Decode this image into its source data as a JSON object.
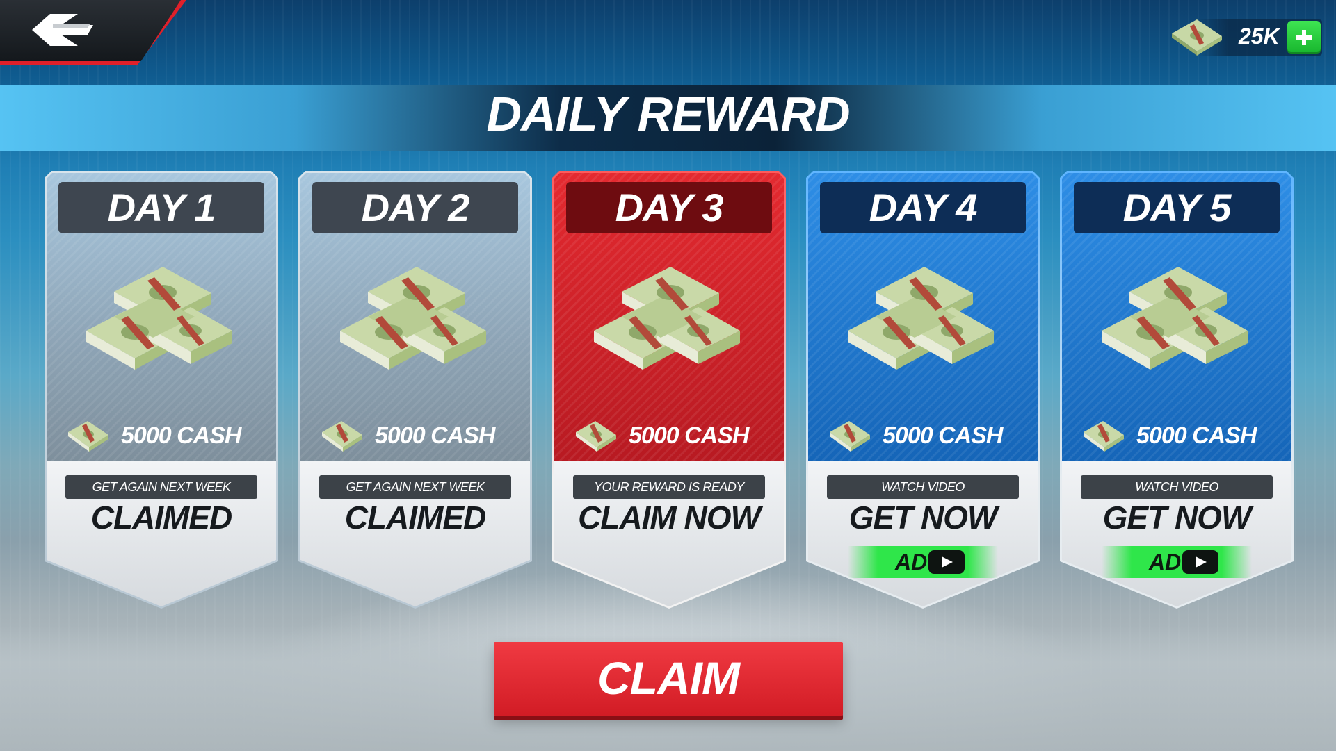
{
  "header": {
    "title": "DAILY REWARD"
  },
  "currency": {
    "value": "25K",
    "icon": "cash-stack-icon",
    "add_icon": "plus-icon"
  },
  "days": [
    {
      "label": "DAY 1",
      "amount": "5000 CASH",
      "status": "GET AGAIN NEXT WEEK",
      "action": "CLAIMED",
      "state": "claimed"
    },
    {
      "label": "DAY 2",
      "amount": "5000 CASH",
      "status": "GET AGAIN NEXT WEEK",
      "action": "CLAIMED",
      "state": "claimed"
    },
    {
      "label": "DAY 3",
      "amount": "5000 CASH",
      "status": "YOUR REWARD IS READY",
      "action": "CLAIM NOW",
      "state": "ready"
    },
    {
      "label": "DAY 4",
      "amount": "5000 CASH",
      "status": "WATCH VIDEO",
      "action": "GET NOW",
      "state": "video",
      "ad_label": "AD"
    },
    {
      "label": "DAY 5",
      "amount": "5000 CASH",
      "status": "WATCH VIDEO",
      "action": "GET NOW",
      "state": "video",
      "ad_label": "AD"
    }
  ],
  "claim_button": {
    "label": "CLAIM"
  },
  "colors": {
    "claimed": "#3e4650",
    "ready": "#e42a30",
    "video": "#2e8ee6",
    "ad_green": "#2fe64a",
    "claim_red": "#e02a33"
  }
}
